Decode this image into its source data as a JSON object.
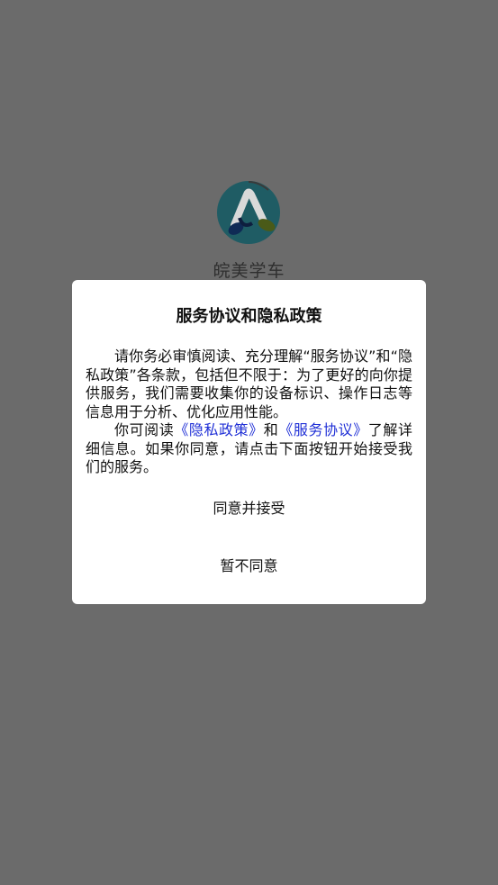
{
  "app": {
    "name": "皖美学车",
    "logo_icon": "app-logo-icon"
  },
  "dialog": {
    "title": "服务协议和隐私政策",
    "paragraph1": "请你务必审慎阅读、充分理解“服务协议”和“隐私政策”各条款，包括但不限于：为了更好的向你提供服务，我们需要收集你的设备标识、操作日志等信息用于分析、优化应用性能。",
    "paragraph2_prefix": "你可阅读",
    "privacy_link": "《隐私政策》",
    "and_text": "和",
    "service_link": "《服务协议》",
    "paragraph2_suffix": "了解详细信息。如果你同意，请点击下面按钮开始接受我们的服务。",
    "agree_button": "同意并接受",
    "disagree_button": "暂不同意"
  },
  "colors": {
    "overlay_background": "#6b6b6b",
    "dialog_background": "#ffffff",
    "link": "#1f2fd6"
  }
}
